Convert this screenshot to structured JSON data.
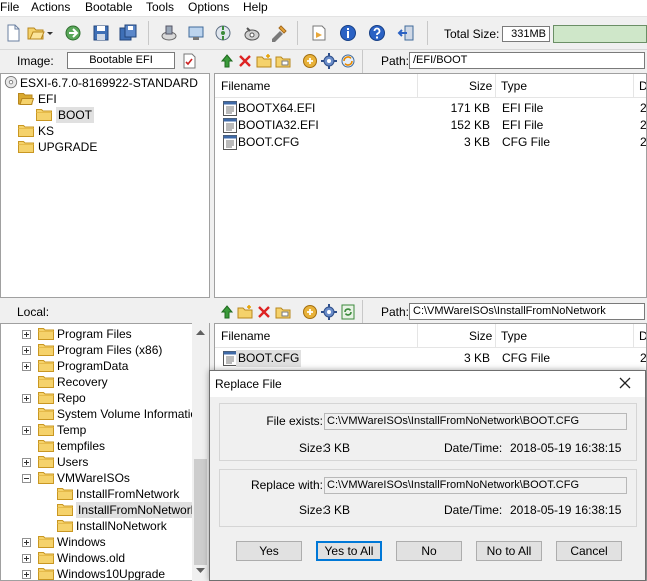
{
  "menu": [
    "File",
    "Actions",
    "Bootable",
    "Tools",
    "Options",
    "Help"
  ],
  "toolbar": {
    "total_size_label": "Total Size:",
    "total_size_value": "331MB",
    "icons": [
      "new-icon",
      "open-icon",
      "extract-icon",
      "save-icon",
      "save-as-icon",
      "burn-icon",
      "mount-icon",
      "compress-icon",
      "checksum-icon",
      "options-icon",
      "properties-icon",
      "about-icon",
      "help-icon",
      "exit-icon"
    ]
  },
  "image_pane": {
    "label": "Image:",
    "image_type": "Bootable EFI",
    "path_label": "Path:",
    "path": "/EFI/BOOT",
    "tree": [
      {
        "label": "ESXI-6.7.0-8169922-STANDARD",
        "icon": "cd-icon",
        "level": 0
      },
      {
        "label": "EFI",
        "icon": "folder-open-icon",
        "level": 1
      },
      {
        "label": "BOOT",
        "icon": "folder-icon",
        "level": 2,
        "selected": true
      },
      {
        "label": "KS",
        "icon": "folder-icon",
        "level": 1
      },
      {
        "label": "UPGRADE",
        "icon": "folder-icon",
        "level": 1
      }
    ],
    "columns": [
      "Filename",
      "Size",
      "Type",
      "D"
    ],
    "files": [
      {
        "name": "BOOTX64.EFI",
        "size": "171 KB",
        "type": "EFI File",
        "date": "2"
      },
      {
        "name": "BOOTIA32.EFI",
        "size": "152 KB",
        "type": "EFI File",
        "date": "2"
      },
      {
        "name": "BOOT.CFG",
        "size": "3 KB",
        "type": "CFG File",
        "date": "2"
      }
    ]
  },
  "local_pane": {
    "label": "Local:",
    "path_label": "Path:",
    "path": "C:\\VMWareISOs\\InstallFromNoNetwork",
    "tree": [
      {
        "label": "Program Files",
        "expander": "plus"
      },
      {
        "label": "Program Files (x86)",
        "expander": "plus"
      },
      {
        "label": "ProgramData",
        "expander": "plus"
      },
      {
        "label": "Recovery",
        "expander": "none"
      },
      {
        "label": "Repo",
        "expander": "plus"
      },
      {
        "label": "System Volume Information",
        "expander": "none"
      },
      {
        "label": "Temp",
        "expander": "plus"
      },
      {
        "label": "tempfiles",
        "expander": "none"
      },
      {
        "label": "Users",
        "expander": "plus"
      },
      {
        "label": "VMWareISOs",
        "expander": "minus"
      },
      {
        "label": "InstallFromNetwork",
        "expander": "child"
      },
      {
        "label": "InstallFromNoNetwork",
        "expander": "child",
        "selected": true
      },
      {
        "label": "InstallNoNetwork",
        "expander": "child"
      },
      {
        "label": "Windows",
        "expander": "plus"
      },
      {
        "label": "Windows.old",
        "expander": "plus"
      },
      {
        "label": "Windows10Upgrade",
        "expander": "plus"
      }
    ],
    "columns": [
      "Filename",
      "Size",
      "Type",
      "D"
    ],
    "files": [
      {
        "name": "BOOT.CFG",
        "size": "3 KB",
        "type": "CFG File",
        "date": "2"
      }
    ]
  },
  "dialog": {
    "title": "Replace File",
    "exists_label": "File exists:",
    "exists_path": "C:\\VMWareISOs\\InstallFromNoNetwork\\BOOT.CFG",
    "exists_size_label": "Size:",
    "exists_size": "3 KB",
    "exists_date_label": "Date/Time:",
    "exists_date": "2018-05-19 16:38:15",
    "replace_label": "Replace with:",
    "replace_path": "C:\\VMWareISOs\\InstallFromNoNetwork\\BOOT.CFG",
    "replace_size_label": "Size:",
    "replace_size": "3 KB",
    "replace_date_label": "Date/Time:",
    "replace_date": "2018-05-19 16:38:15",
    "buttons": {
      "yes": "Yes",
      "yes_all": "Yes to All",
      "no": "No",
      "no_all": "No to All",
      "cancel": "Cancel"
    }
  },
  "colors": {
    "folder": "#f5d26b",
    "folder_dark": "#d9a92f",
    "accent": "#0078d7"
  }
}
